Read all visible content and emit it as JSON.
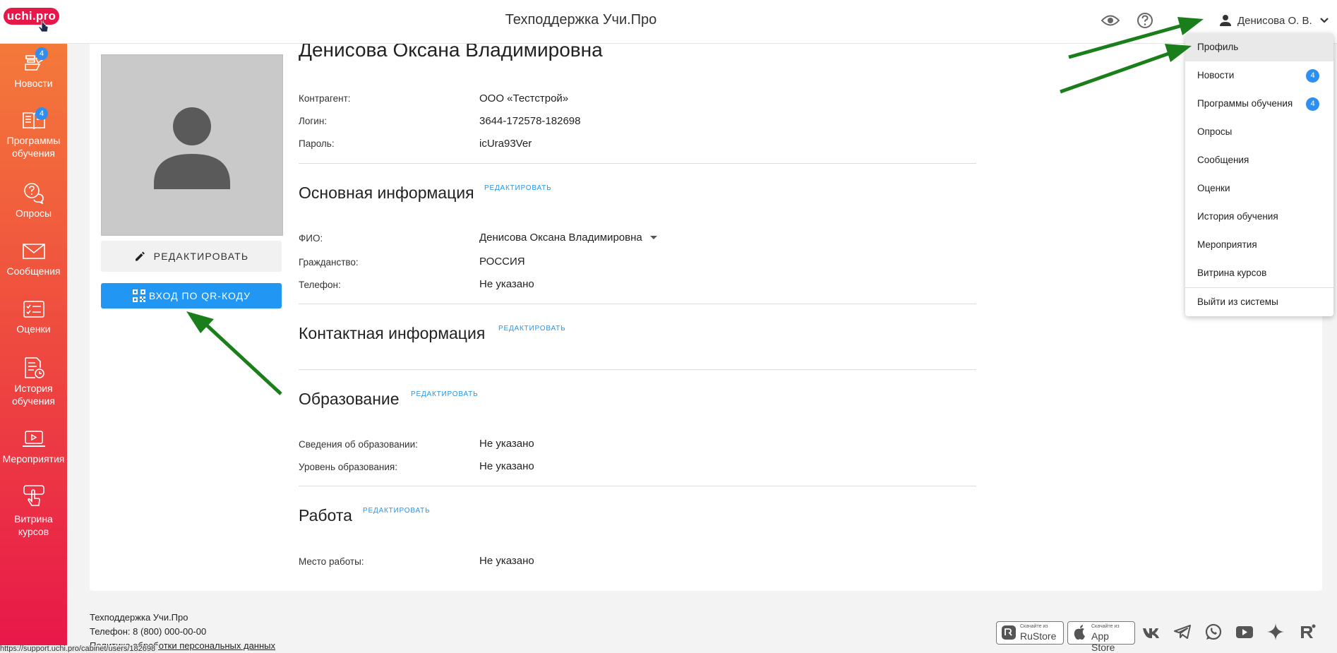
{
  "app": {
    "logo_text": "uchi.pro",
    "title": "Техподдержка Учи.Про",
    "user_name": "Денисова О. В."
  },
  "sidebar": {
    "items": [
      {
        "label": "Новости",
        "badge": "4",
        "icon": "news-icon"
      },
      {
        "label": "Программы обучения",
        "badge": "4",
        "icon": "book-icon"
      },
      {
        "label": "Опросы",
        "icon": "survey-icon"
      },
      {
        "label": "Сообщения",
        "icon": "envelope-icon"
      },
      {
        "label": "Оценки",
        "icon": "grades-icon"
      },
      {
        "label": "История обучения",
        "icon": "history-icon"
      },
      {
        "label": "Мероприятия",
        "icon": "laptop-icon"
      },
      {
        "label": "Витрина курсов",
        "icon": "hand-pointer-icon"
      }
    ]
  },
  "profile": {
    "full_name": "Денисова Оксана Владимировна",
    "edit_button": "РЕДАКТИРОВАТЬ",
    "qr_button": "ВХОД ПО QR-КОДУ",
    "account": [
      {
        "label": "Контрагент:",
        "value": "ООО «Тестстрой»"
      },
      {
        "label": "Логин:",
        "value": "3644-172578-182698"
      },
      {
        "label": "Пароль:",
        "value": "icUra93Ver"
      }
    ],
    "edit_link": "РЕДАКТИРОВАТЬ",
    "sections": {
      "basic": {
        "title": "Основная информация",
        "fields": [
          {
            "label": "ФИО:",
            "value": "Денисова Оксана Владимировна"
          },
          {
            "label": "Гражданство:",
            "value": "РОССИЯ"
          },
          {
            "label": "Телефон:",
            "value": "Не указано"
          }
        ]
      },
      "contact": {
        "title": "Контактная информация"
      },
      "education": {
        "title": "Образование",
        "fields": [
          {
            "label": "Сведения об образовании:",
            "value": "Не указано"
          },
          {
            "label": "Уровень образования:",
            "value": "Не указано"
          }
        ]
      },
      "work": {
        "title": "Работа",
        "fields": [
          {
            "label": "Место работы:",
            "value": "Не указано"
          }
        ]
      }
    }
  },
  "dropdown": {
    "items": [
      {
        "label": "Профиль"
      },
      {
        "label": "Новости",
        "badge": "4"
      },
      {
        "label": "Программы обучения",
        "badge": "4"
      },
      {
        "label": "Опросы"
      },
      {
        "label": "Сообщения"
      },
      {
        "label": "Оценки"
      },
      {
        "label": "История обучения"
      },
      {
        "label": "Мероприятия"
      },
      {
        "label": "Витрина курсов"
      }
    ],
    "logout": "Выйти из системы"
  },
  "footer": {
    "title": "Техподдержка Учи.Про",
    "phone": "Телефон: 8 (800) 000-00-00",
    "privacy": "Политика обработки персональных данных",
    "rustore_small": "Скачайте из",
    "rustore": "RuStore",
    "appstore_small": "Скачайте из",
    "appstore": "App Store",
    "social_icons": [
      "vk-icon",
      "telegram-icon",
      "whatsapp-icon",
      "youtube-icon",
      "star-icon",
      "rutube-icon"
    ]
  },
  "status_bar": {
    "url": "https://support.uchi.pro/cabinet/users/182698"
  },
  "colors": {
    "brand": "#e8174a",
    "sidebar_top": "#f4793a",
    "accent_blue": "#2196f3",
    "annotation_arrow": "#1a7f1a"
  }
}
